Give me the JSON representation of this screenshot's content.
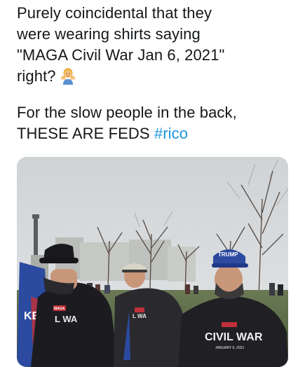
{
  "tweet": {
    "line1": "Purely coincidental that they",
    "line2": "were wearing shirts saying",
    "line3": "\"MAGA Civil War Jan 6, 2021\"",
    "line4": "right?",
    "emoji": "man-shrugging-emoji",
    "line5": "For the slow people in the back,",
    "line6_prefix": "THESE ARE FEDS ",
    "hashtag": "#rico"
  },
  "photo": {
    "hat_text": "TRUMP",
    "shirt_left": "KE",
    "shirt_mid": "L WA",
    "shirt_right_main": "CIVIL WAR",
    "shirt_right_sub": "JANUARY 6, 2021",
    "badge": "MAGA"
  },
  "colors": {
    "hashtag": "#1b95e0",
    "text": "#14171a",
    "sky": "#d7dadc"
  }
}
